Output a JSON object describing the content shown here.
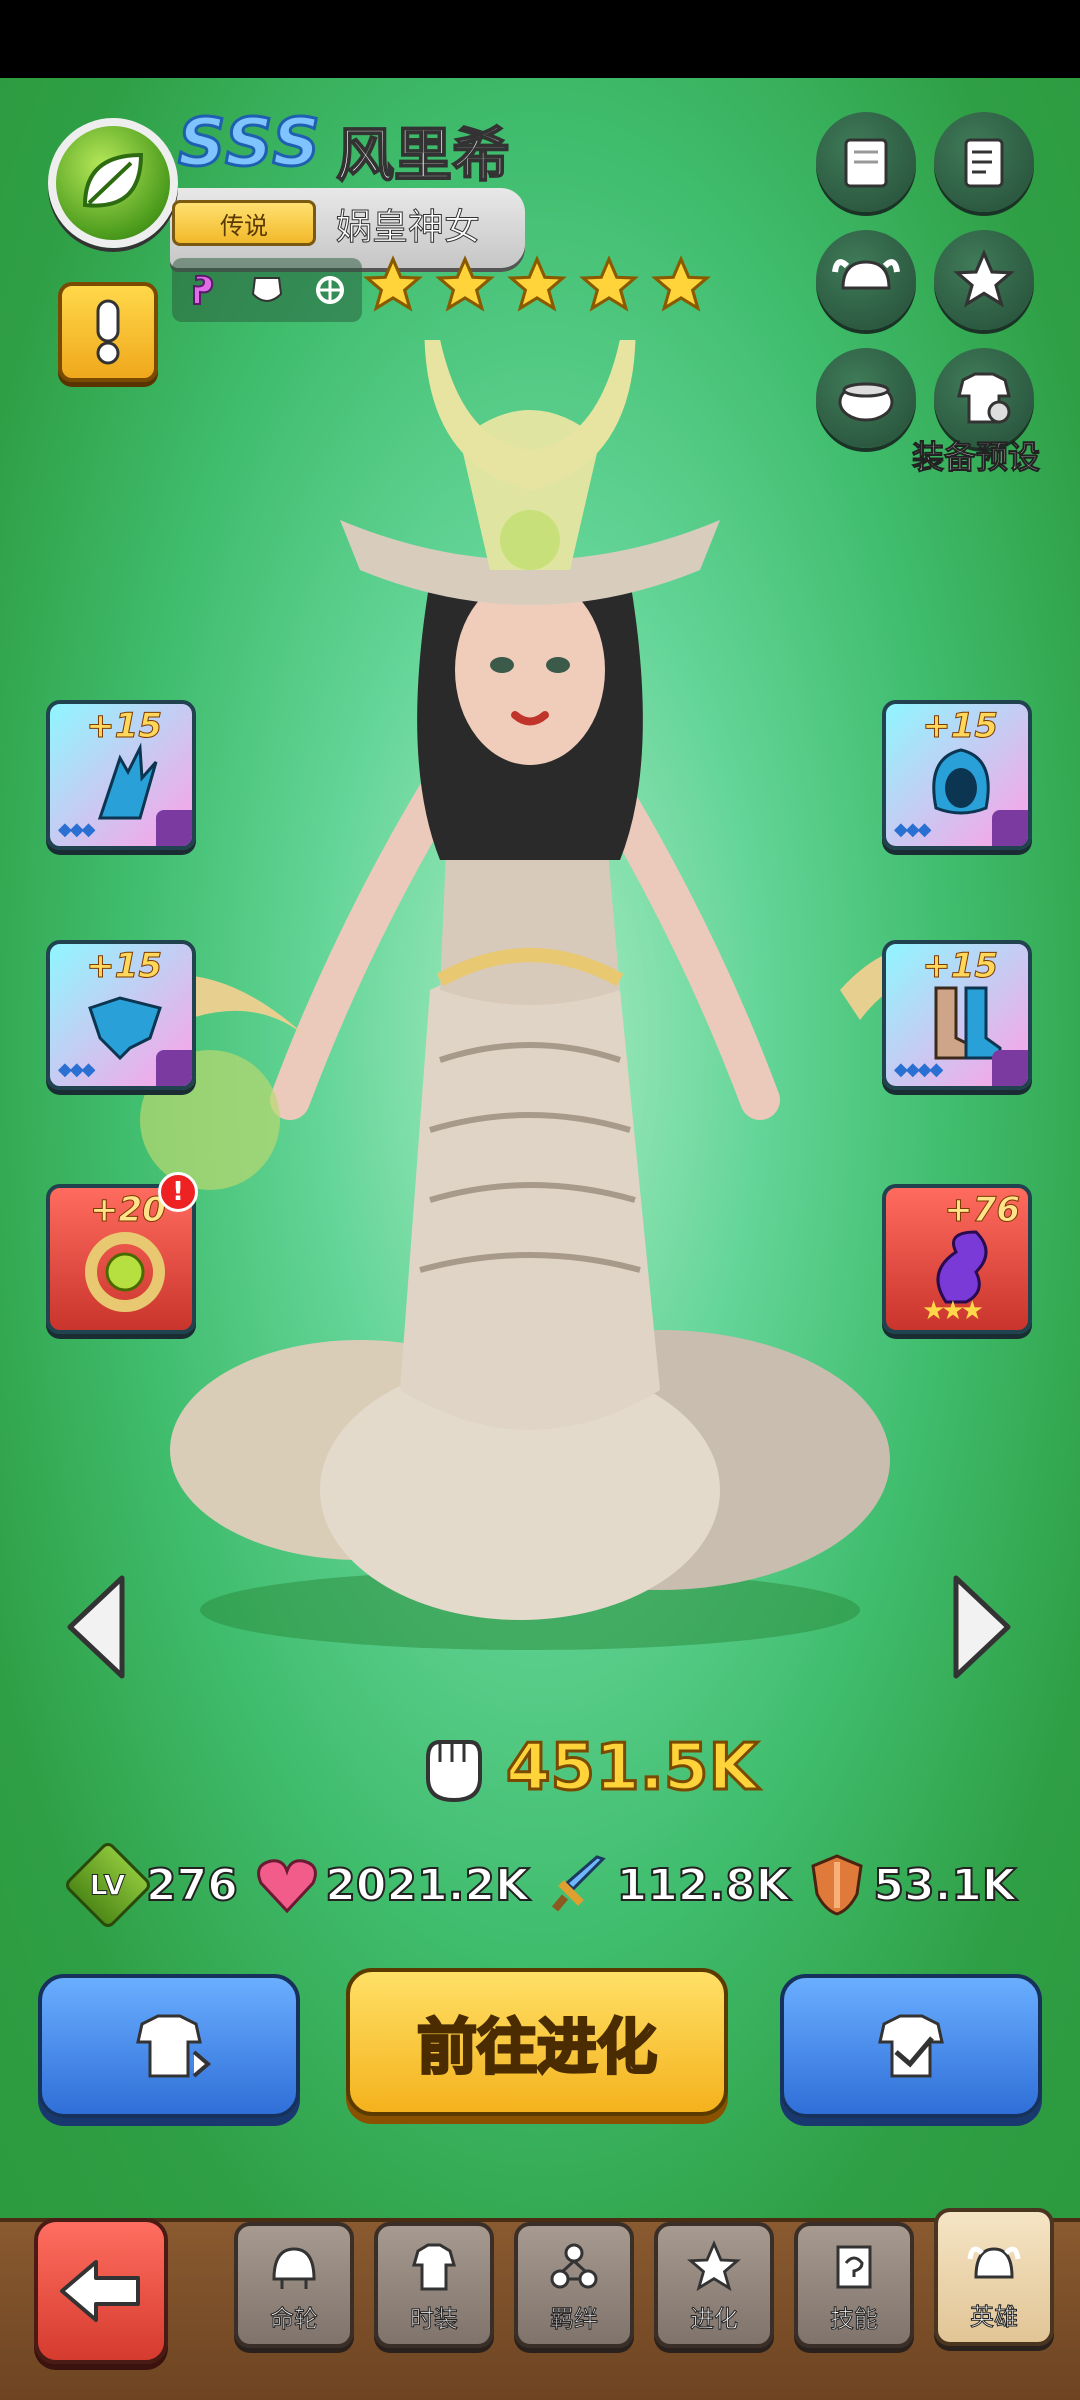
{
  "hero": {
    "rank": "SSS",
    "name": "风里希",
    "rarity": "传说",
    "title": "娲皇神女",
    "star_count": 5
  },
  "preset_label": "装备预设",
  "equipment": {
    "left": [
      {
        "level": "+15",
        "gems": "◆◆◆"
      },
      {
        "level": "+15",
        "gems": "◆◆◆"
      },
      {
        "level": "+20",
        "alert": "!"
      }
    ],
    "right": [
      {
        "level": "+15",
        "gems": "◆◆◆"
      },
      {
        "level": "+15",
        "gems": "◆◆◆◆"
      },
      {
        "level": "+76",
        "stars": "★★★"
      }
    ]
  },
  "power": "451.5K",
  "stats": {
    "level_badge": "LV",
    "level": "276",
    "hp": "2021.2K",
    "attack": "112.8K",
    "defense": "53.1K"
  },
  "actions": {
    "evolve_label": "前往进化"
  },
  "tabs": [
    {
      "label": "命轮",
      "icon": "helmet-icon"
    },
    {
      "label": "时装",
      "icon": "shirt-icon"
    },
    {
      "label": "羁绊",
      "icon": "link-icon"
    },
    {
      "label": "进化",
      "icon": "star-icon"
    },
    {
      "label": "技能",
      "icon": "scroll-icon"
    },
    {
      "label": "英雄",
      "icon": "viking-helmet-icon",
      "active": true
    }
  ]
}
